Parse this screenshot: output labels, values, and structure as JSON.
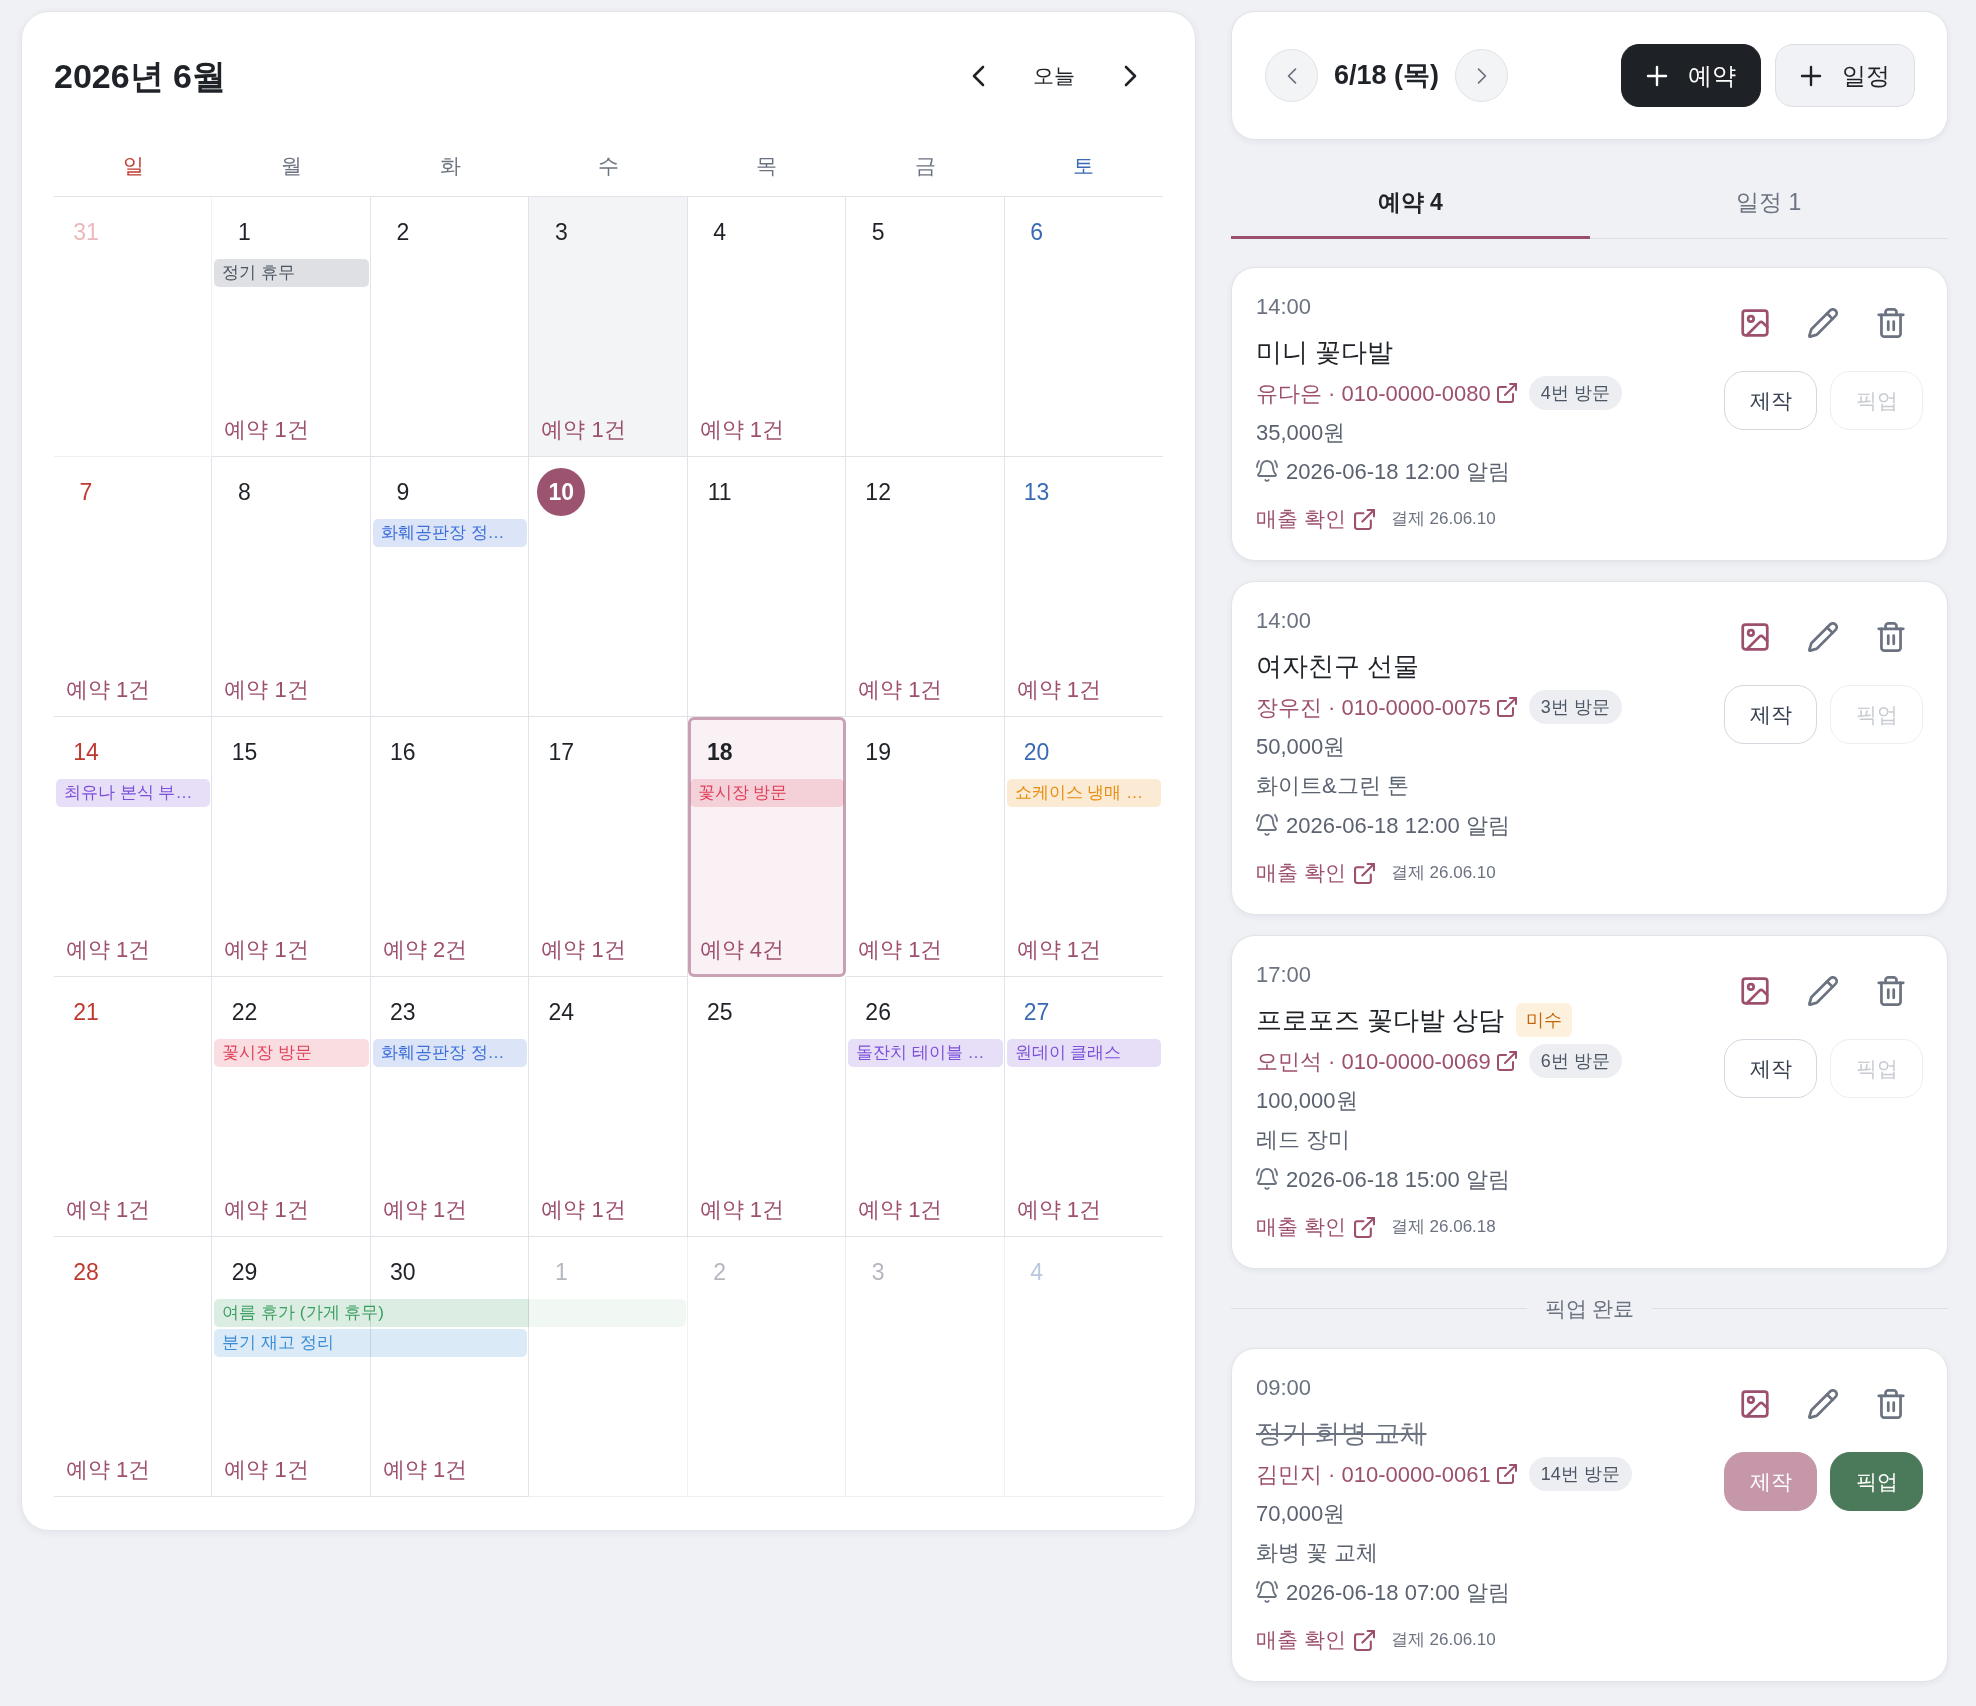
{
  "calendar": {
    "title": "2026년 6월",
    "today_button": "오늘",
    "weekdays": [
      {
        "label": "일",
        "kind": "sunday"
      },
      {
        "label": "월",
        "kind": "weekday"
      },
      {
        "label": "화",
        "kind": "weekday"
      },
      {
        "label": "수",
        "kind": "weekday"
      },
      {
        "label": "목",
        "kind": "weekday"
      },
      {
        "label": "금",
        "kind": "weekday"
      },
      {
        "label": "토",
        "kind": "saturday"
      }
    ],
    "weeks": [
      {
        "days": [
          {
            "label": "31",
            "outside": true,
            "today": false,
            "selected": false,
            "shaded": false
          },
          {
            "label": "1",
            "outside": false,
            "today": false,
            "selected": false,
            "shaded": false,
            "events": [
              {
                "kind": "bar",
                "label": "정기 휴무",
                "color": "#4b5563"
              }
            ],
            "count": "예약 1건"
          },
          {
            "label": "2",
            "outside": false,
            "today": false,
            "selected": false,
            "shaded": false
          },
          {
            "label": "3",
            "outside": false,
            "today": false,
            "selected": false,
            "shaded": true,
            "count": "예약 1건"
          },
          {
            "label": "4",
            "outside": false,
            "today": false,
            "selected": false,
            "shaded": false,
            "count": "예약 1건"
          },
          {
            "label": "5",
            "outside": false,
            "today": false,
            "selected": false,
            "shaded": false
          },
          {
            "label": "6",
            "outside": false,
            "today": false,
            "selected": false,
            "shaded": false
          }
        ]
      },
      {
        "days": [
          {
            "label": "7",
            "outside": false,
            "today": false,
            "selected": false,
            "shaded": false,
            "count": "예약 1건"
          },
          {
            "label": "8",
            "outside": false,
            "today": false,
            "selected": false,
            "shaded": false,
            "count": "예약 1건"
          },
          {
            "label": "9",
            "outside": false,
            "today": false,
            "selected": false,
            "shaded": false,
            "events": [
              {
                "kind": "bar",
                "label": "화훼공판장 정…",
                "color": "#3d6fd9"
              }
            ]
          },
          {
            "label": "10",
            "outside": false,
            "today": true,
            "selected": false,
            "shaded": false
          },
          {
            "label": "11",
            "outside": false,
            "today": false,
            "selected": false,
            "shaded": false
          },
          {
            "label": "12",
            "outside": false,
            "today": false,
            "selected": false,
            "shaded": false,
            "count": "예약 1건"
          },
          {
            "label": "13",
            "outside": false,
            "today": false,
            "selected": false,
            "shaded": false,
            "count": "예약 1건"
          }
        ]
      },
      {
        "days": [
          {
            "label": "14",
            "outside": false,
            "today": false,
            "selected": false,
            "shaded": false,
            "events": [
              {
                "kind": "bar",
                "label": "최유나 본식 부…",
                "color": "#7c4fd9"
              }
            ],
            "count": "예약 1건"
          },
          {
            "label": "15",
            "outside": false,
            "today": false,
            "selected": false,
            "shaded": false,
            "count": "예약 1건"
          },
          {
            "label": "16",
            "outside": false,
            "today": false,
            "selected": false,
            "shaded": false,
            "count": "예약 2건"
          },
          {
            "label": "17",
            "outside": false,
            "today": false,
            "selected": false,
            "shaded": false,
            "count": "예약 1건"
          },
          {
            "label": "18",
            "outside": false,
            "today": false,
            "selected": true,
            "shaded": false,
            "events": [
              {
                "kind": "bar",
                "label": "꽃시장 방문",
                "color": "#e0405a"
              }
            ],
            "count": "예약 4건"
          },
          {
            "label": "19",
            "outside": false,
            "today": false,
            "selected": false,
            "shaded": false,
            "count": "예약 1건"
          },
          {
            "label": "20",
            "outside": false,
            "today": false,
            "selected": false,
            "shaded": false,
            "events": [
              {
                "kind": "bar",
                "label": "쇼케이스 냉매 …",
                "color": "#e88d0e"
              }
            ],
            "count": "예약 1건"
          }
        ]
      },
      {
        "days": [
          {
            "label": "21",
            "outside": false,
            "today": false,
            "selected": false,
            "shaded": false,
            "count": "예약 1건"
          },
          {
            "label": "22",
            "outside": false,
            "today": false,
            "selected": false,
            "shaded": false,
            "events": [
              {
                "kind": "bar",
                "label": "꽃시장 방문",
                "color": "#e0405a"
              }
            ],
            "count": "예약 1건"
          },
          {
            "label": "23",
            "outside": false,
            "today": false,
            "selected": false,
            "shaded": false,
            "events": [
              {
                "kind": "bar",
                "label": "화훼공판장 정…",
                "color": "#3d6fd9"
              }
            ],
            "count": "예약 1건"
          },
          {
            "label": "24",
            "outside": false,
            "today": false,
            "selected": false,
            "shaded": false,
            "count": "예약 1건"
          },
          {
            "label": "25",
            "outside": false,
            "today": false,
            "selected": false,
            "shaded": false,
            "count": "예약 1건"
          },
          {
            "label": "26",
            "outside": false,
            "today": false,
            "selected": false,
            "shaded": false,
            "events": [
              {
                "kind": "bar",
                "label": "돌잔치 테이블 …",
                "color": "#7c4fd9"
              }
            ],
            "count": "예약 1건"
          },
          {
            "label": "27",
            "outside": false,
            "today": false,
            "selected": false,
            "shaded": false,
            "events": [
              {
                "kind": "bar",
                "label": "원데이 클래스",
                "color": "#7c4fd9"
              }
            ],
            "count": "예약 1건"
          }
        ]
      },
      {
        "days": [
          {
            "label": "28",
            "outside": false,
            "today": false,
            "selected": false,
            "shaded": false,
            "count": "예약 1건"
          },
          {
            "label": "29",
            "outside": false,
            "today": false,
            "selected": false,
            "shaded": false,
            "events": [
              {
                "kind": "bar",
                "label": "여름 휴가 (가게 휴무)",
                "color": "#3a9e5f"
              },
              {
                "kind": "bar",
                "label": "분기 재고 정리",
                "color": "#3a8cd6"
              }
            ],
            "count": "예약 1건"
          },
          {
            "label": "30",
            "outside": false,
            "today": false,
            "selected": false,
            "shaded": false,
            "events": [
              {
                "kind": "continuation"
              },
              {
                "kind": "continuation"
              }
            ],
            "count": "예약 1건"
          },
          {
            "label": "1",
            "outside": true,
            "today": false,
            "selected": false,
            "shaded": false,
            "events": [
              {
                "kind": "continuation"
              }
            ]
          },
          {
            "label": "2",
            "outside": true,
            "today": false,
            "selected": false,
            "shaded": false
          },
          {
            "label": "3",
            "outside": true,
            "today": false,
            "selected": false,
            "shaded": false
          },
          {
            "label": "4",
            "outside": true,
            "today": false,
            "selected": false,
            "shaded": false
          }
        ]
      }
    ]
  },
  "day_panel": {
    "date": "6/18 (목)",
    "add_buttons": [
      {
        "label": "예약",
        "kind": "primary"
      },
      {
        "label": "일정",
        "kind": "secondary"
      }
    ],
    "tabs": [
      {
        "label": "예약 4",
        "selected": true
      },
      {
        "label": "일정 1",
        "selected": false
      }
    ],
    "reservations": [
      {
        "time": "14:00",
        "title": "미니 꽃다발",
        "completed": false,
        "customer": "유다은 · 010-0000-0080",
        "visits": "4번 방문",
        "amount": "35,000원",
        "alarm": "2026-06-18 12:00 알림",
        "sales_link": "매출 확인",
        "payment": "결제 26.06.10",
        "make": {
          "label": "제작",
          "active": false,
          "disabled": false
        },
        "pickup": {
          "label": "픽업",
          "active": false,
          "disabled": true
        }
      },
      {
        "time": "14:00",
        "title": "여자친구 선물",
        "completed": false,
        "customer": "장우진 · 010-0000-0075",
        "visits": "3번 방문",
        "amount": "50,000원",
        "note": "화이트&그린 톤",
        "alarm": "2026-06-18 12:00 알림",
        "sales_link": "매출 확인",
        "payment": "결제 26.06.10",
        "make": {
          "label": "제작",
          "active": false,
          "disabled": false
        },
        "pickup": {
          "label": "픽업",
          "active": false,
          "disabled": true
        }
      },
      {
        "time": "17:00",
        "title": "프로포즈 꽃다발 상담",
        "badge": "미수",
        "completed": false,
        "customer": "오민석 · 010-0000-0069",
        "visits": "6번 방문",
        "amount": "100,000원",
        "note": "레드 장미",
        "alarm": "2026-06-18 15:00 알림",
        "sales_link": "매출 확인",
        "payment": "결제 26.06.18",
        "make": {
          "label": "제작",
          "active": false,
          "disabled": false
        },
        "pickup": {
          "label": "픽업",
          "active": false,
          "disabled": true
        }
      }
    ],
    "completed_section": {
      "label": "픽업 완료",
      "reservations": [
        {
          "time": "09:00",
          "title": "정기 화병 교체",
          "completed": true,
          "customer": "김민지 · 010-0000-0061",
          "visits": "14번 방문",
          "amount": "70,000원",
          "note": "화병 꽃 교체",
          "alarm": "2026-06-18 07:00 알림",
          "sales_link": "매출 확인",
          "payment": "결제 26.06.10",
          "make": {
            "label": "제작",
            "active": true,
            "disabled": false
          },
          "pickup": {
            "label": "픽업",
            "active": true,
            "disabled": false
          }
        }
      ]
    }
  }
}
